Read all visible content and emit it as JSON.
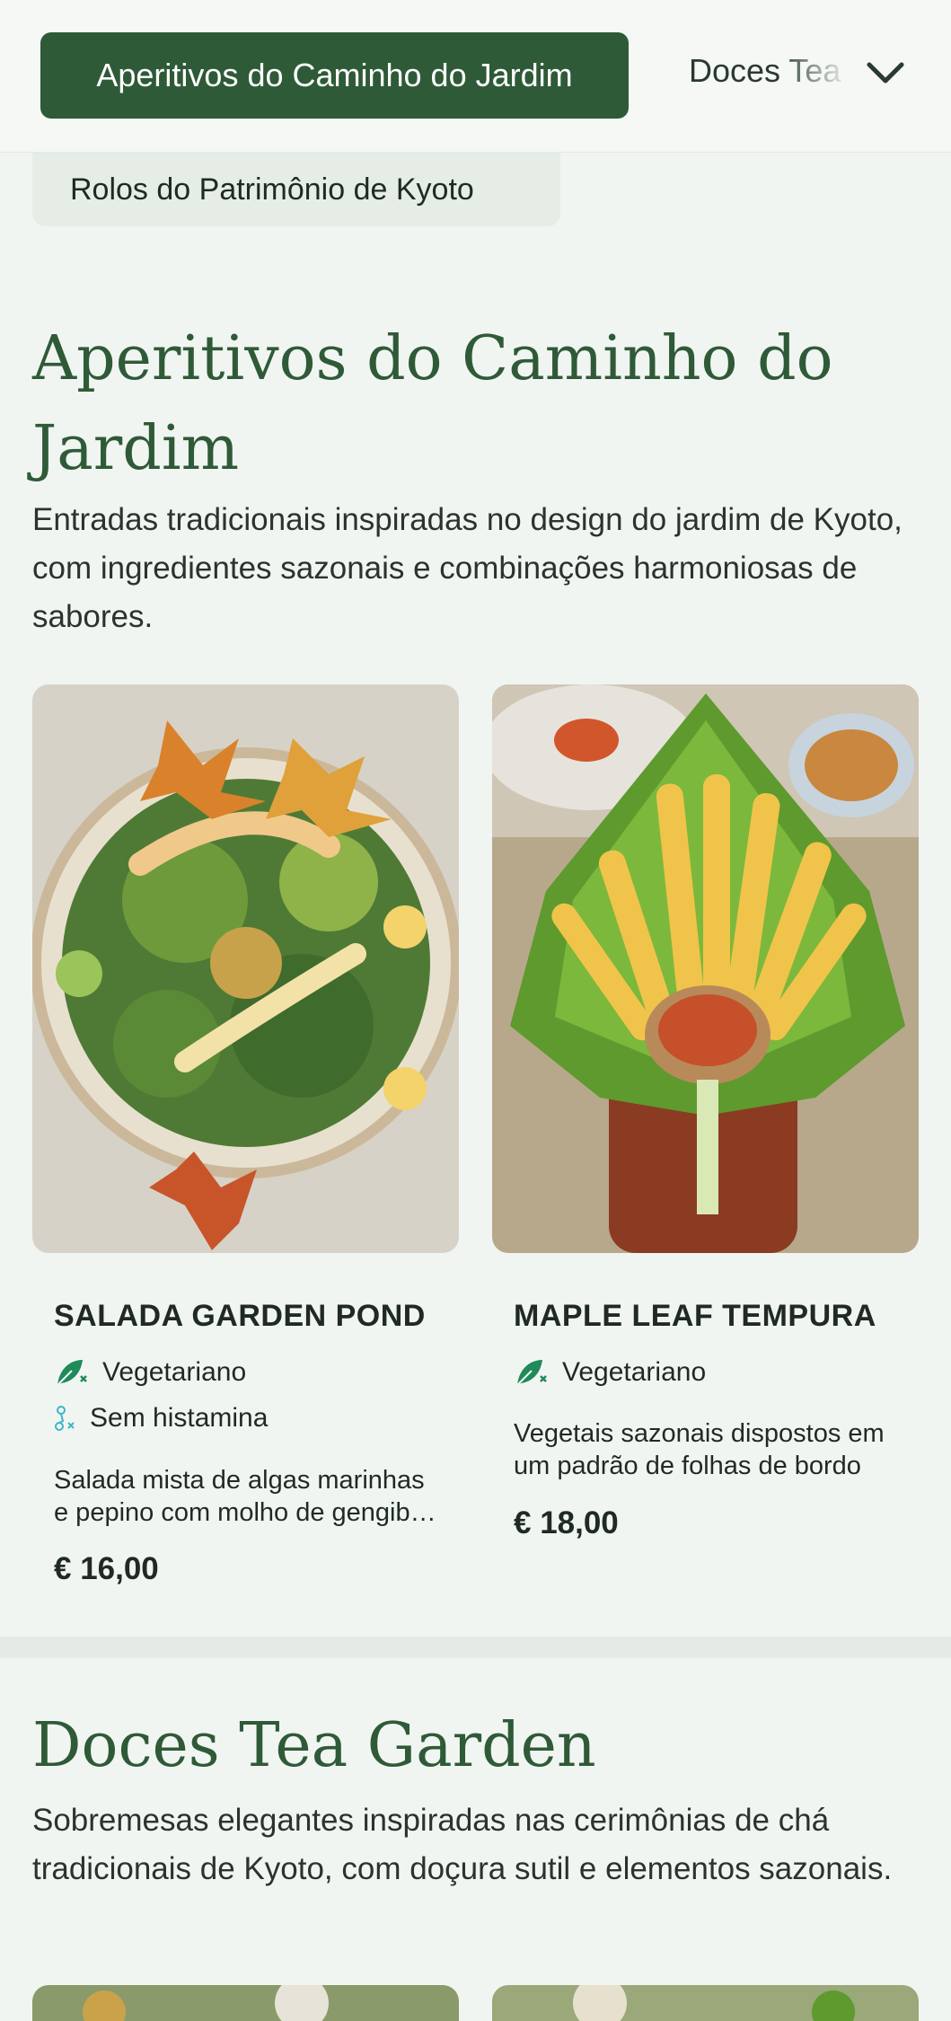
{
  "nav": {
    "active_tab": "Aperitivos do Caminho do Jardim",
    "next_tab": "Doces Tea Garden",
    "second_row_tab": "Rolos do Patrimônio de Kyoto"
  },
  "sections": [
    {
      "title": "Aperitivos do Caminho do Jardim",
      "description": "Entradas tradicionais inspiradas no design do jardim de Kyoto, com ingredientes sazonais e combinações harmoniosas de sabores.",
      "items": [
        {
          "name": "SALADA GARDEN POND",
          "tags": [
            "Vegetariano",
            "Sem histamina"
          ],
          "description": "Salada mista de algas marinhas e pepino com molho de gengibre e gergelim",
          "price": "€ 16,00"
        },
        {
          "name": "MAPLE LEAF TEMPURA",
          "tags": [
            "Vegetariano"
          ],
          "description": "Vegetais sazonais dispostos em um padrão de folhas de bordo",
          "price": "€ 18,00"
        }
      ]
    },
    {
      "title": "Doces Tea Garden",
      "description": "Sobremesas elegantes inspiradas nas cerimônias de chá tradicionais de Kyoto, com doçura sutil e elementos sazonais."
    }
  ],
  "colors": {
    "brand_green": "#2f5a38",
    "background": "#f1f5f1",
    "vegetarian_icon": "#1f8a5a",
    "histamine_icon": "#3bb6c9"
  },
  "icons": {
    "chevron": "chevron-down-icon",
    "vegetarian": "leaf-icon",
    "histamine_free": "molecule-icon"
  }
}
